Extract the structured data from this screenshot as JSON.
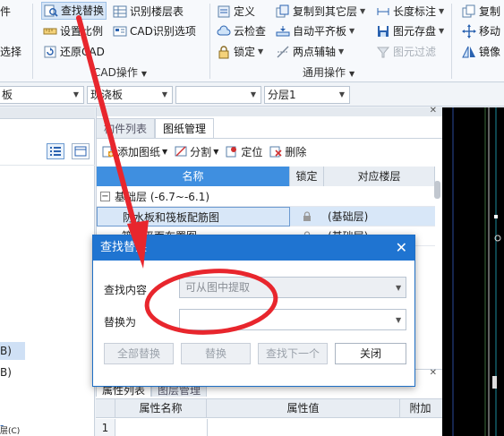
{
  "ribbon": {
    "col0": {
      "item1": "件",
      "item2": "选择"
    },
    "col1": {
      "find_replace": "查找替换",
      "set_scale": "设置比例",
      "restore_cad": "还原CAD"
    },
    "col2": {
      "identify_floor_table": "识别楼层表",
      "cad_options": "CAD识别选项"
    },
    "cad_group_label": "CAD操作",
    "col3": {
      "define": "定义",
      "cloud_check": "云检查",
      "lock": "锁定"
    },
    "col4": {
      "copy_to_floor": "复制到其它层",
      "auto_align": "自动平齐板",
      "two_point_axis": "两点辅轴"
    },
    "col5": {
      "length_label": "长度标注",
      "save_image": "图元存盘",
      "filter": "图元过滤"
    },
    "general_group_label": "通用操作",
    "col6": {
      "copy": "复制",
      "move": "移动",
      "mirror": "镜像"
    }
  },
  "toolbar2": {
    "dd1": "板",
    "dd2": "现浇板",
    "dd3": "",
    "dd4": "分层1"
  },
  "left_panel": {
    "item_b1": "B)",
    "item_b2": "B)",
    "item_c": "层(C)"
  },
  "drawing_panel": {
    "tab_members": "构件列表",
    "tab_drawings": "图纸管理",
    "tools": {
      "add_drawing": "添加图纸",
      "split": "分割",
      "locate": "定位",
      "delete": "删除"
    },
    "columns": {
      "name": "名称",
      "lock": "锁定",
      "floor": "对应楼层"
    },
    "group_row": "基础层 (-6.7~-6.1)",
    "rows": [
      {
        "name": "防水板和筏板配筋图",
        "floor": "(基础层)"
      },
      {
        "name": "筏板平面布置图",
        "floor": "(基础层)"
      }
    ]
  },
  "attr_panel": {
    "tab_props": "属性列表",
    "tab_layers": "图层管理",
    "columns": {
      "name": "属性名称",
      "value": "属性值",
      "extra": "附加"
    },
    "row_index": "1"
  },
  "dialog": {
    "title": "查找替换",
    "find_label": "查找内容",
    "find_placeholder": "可从图中提取",
    "replace_label": "替换为",
    "replace_value": "",
    "btn_replace_all": "全部替换",
    "btn_replace": "替换",
    "btn_find_next": "查找下一个",
    "btn_close": "关闭"
  },
  "colors": {
    "accent": "#1f74d1",
    "annotation_red": "#e8262d"
  }
}
